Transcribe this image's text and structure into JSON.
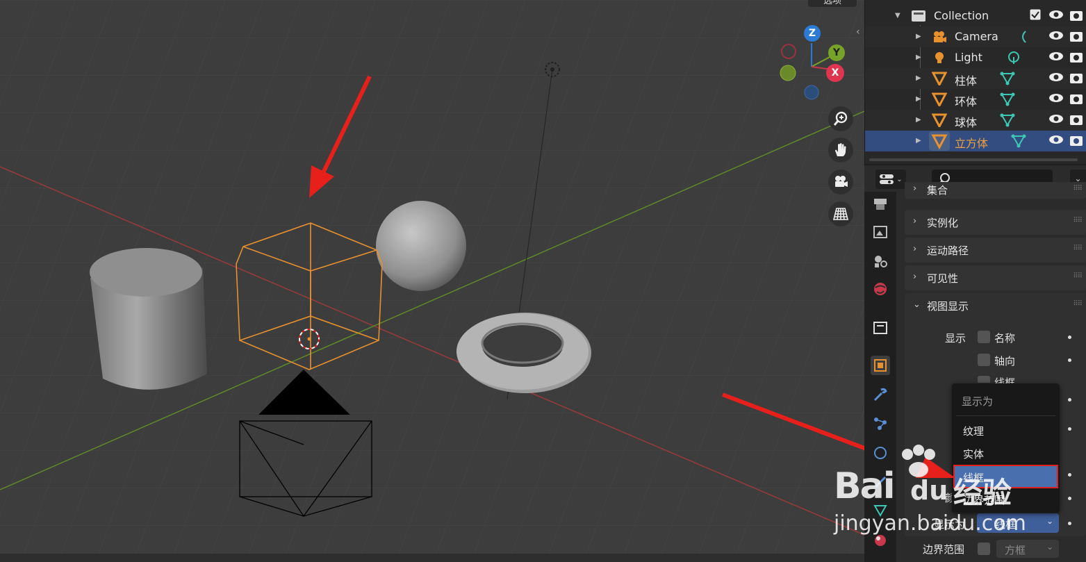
{
  "viewport": {
    "options_label": "选项",
    "gizmo": {
      "z": "Z",
      "y": "Y",
      "x": "X"
    },
    "nav_icons": [
      "zoom-icon",
      "hand-icon",
      "camera-view-icon",
      "grid-perspective-icon"
    ]
  },
  "outliner": {
    "rows": [
      {
        "label": "Collection",
        "type": "collection"
      },
      {
        "label": "Camera",
        "type": "camera"
      },
      {
        "label": "Light",
        "type": "light"
      },
      {
        "label": "柱体",
        "type": "mesh"
      },
      {
        "label": "环体",
        "type": "mesh"
      },
      {
        "label": "球体",
        "type": "mesh"
      },
      {
        "label": "立方体",
        "type": "mesh",
        "selected": true
      }
    ]
  },
  "properties": {
    "panels": [
      {
        "label": "集合",
        "expanded": false
      },
      {
        "label": "实例化",
        "expanded": false
      },
      {
        "label": "运动路径",
        "expanded": false
      },
      {
        "label": "可见性",
        "expanded": false
      },
      {
        "label": "视图显示",
        "expanded": true
      }
    ],
    "viewport_display": {
      "show_label": "显示",
      "name_label": "名称",
      "axis_label": "轴向",
      "wire_label": "线框",
      "display_as_label_partial": "显示为",
      "display_as_value": "线框",
      "color_label_partial": "颜",
      "bounds_label": "边界范围",
      "bounds_value": "方框"
    }
  },
  "popup": {
    "title": "显示为",
    "items": [
      "纹理",
      "实体",
      "线框",
      "边界范围"
    ],
    "selected": "线框"
  },
  "watermark": {
    "brand": "Bai",
    "brand2": "du",
    "cn": "经验",
    "url": "jingyan.baidu.com"
  },
  "colors": {
    "accent_orange": "#e8912f",
    "selection_blue": "#334d80",
    "arrow_red": "#e8201c"
  }
}
